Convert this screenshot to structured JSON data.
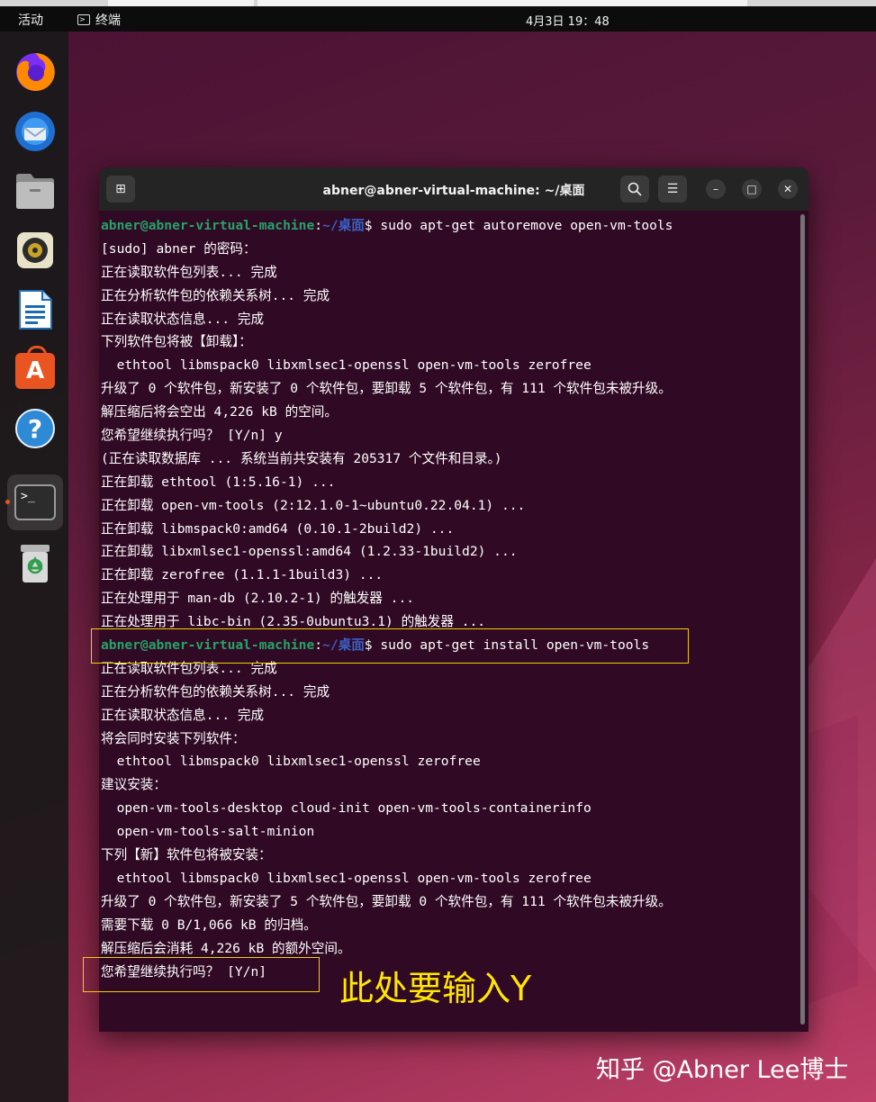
{
  "topbar": {
    "activities": "活动",
    "app_name": "终端",
    "clock": "4月3日 19：48"
  },
  "dock": {
    "items": [
      {
        "icon": "firefox-icon"
      },
      {
        "icon": "thunderbird-icon"
      },
      {
        "icon": "files-icon"
      },
      {
        "icon": "rhythmbox-icon"
      },
      {
        "icon": "libreoffice-writer-icon"
      },
      {
        "icon": "app-center-icon"
      },
      {
        "icon": "help-icon"
      },
      {
        "icon": "terminal-icon"
      },
      {
        "icon": "trash-icon"
      }
    ],
    "help_glyph": "?",
    "app_center_glyph": "A",
    "terminal_glyph": ">_"
  },
  "window": {
    "title": "abner@abner-virtual-machine: ~/桌面",
    "search_glyph": "🔍",
    "menu_glyph": "☰",
    "minimize_glyph": "–",
    "maximize_glyph": "□",
    "close_glyph": "✕",
    "newtab_glyph": "⊞"
  },
  "terminal": {
    "prompt_user": "abner@abner-virtual-machine",
    "prompt_sep": ":",
    "prompt_path": "~/桌面",
    "prompt_dollar": "$ ",
    "lines": [
      {
        "type": "prompt",
        "cmd": "sudo apt-get autoremove open-vm-tools"
      },
      {
        "type": "text",
        "text": "[sudo] abner 的密码："
      },
      {
        "type": "text",
        "text": "正在读取软件包列表... 完成"
      },
      {
        "type": "text",
        "text": "正在分析软件包的依赖关系树... 完成"
      },
      {
        "type": "text",
        "text": "正在读取状态信息... 完成"
      },
      {
        "type": "text",
        "text": "下列软件包将被【卸载】："
      },
      {
        "type": "text",
        "text": "  ethtool libmspack0 libxmlsec1-openssl open-vm-tools zerofree"
      },
      {
        "type": "text",
        "text": "升级了 0 个软件包，新安装了 0 个软件包，要卸载 5 个软件包，有 111 个软件包未被升级。"
      },
      {
        "type": "text",
        "text": "解压缩后将会空出 4,226 kB 的空间。"
      },
      {
        "type": "text",
        "text": "您希望继续执行吗？ [Y/n] y"
      },
      {
        "type": "text",
        "text": "(正在读取数据库 ... 系统当前共安装有 205317 个文件和目录。)"
      },
      {
        "type": "text",
        "text": "正在卸载 ethtool (1:5.16-1) ..."
      },
      {
        "type": "text",
        "text": "正在卸载 open-vm-tools (2:12.1.0-1~ubuntu0.22.04.1) ..."
      },
      {
        "type": "text",
        "text": "正在卸载 libmspack0:amd64 (0.10.1-2build2) ..."
      },
      {
        "type": "text",
        "text": "正在卸载 libxmlsec1-openssl:amd64 (1.2.33-1build2) ..."
      },
      {
        "type": "text",
        "text": "正在卸载 zerofree (1.1.1-1build3) ..."
      },
      {
        "type": "text",
        "text": "正在处理用于 man-db (2.10.2-1) 的触发器 ..."
      },
      {
        "type": "text",
        "text": "正在处理用于 libc-bin (2.35-0ubuntu3.1) 的触发器 ..."
      },
      {
        "type": "prompt",
        "cmd": "sudo apt-get install open-vm-tools"
      },
      {
        "type": "text",
        "text": "正在读取软件包列表... 完成"
      },
      {
        "type": "text",
        "text": "正在分析软件包的依赖关系树... 完成"
      },
      {
        "type": "text",
        "text": "正在读取状态信息... 完成"
      },
      {
        "type": "text",
        "text": "将会同时安装下列软件："
      },
      {
        "type": "text",
        "text": "  ethtool libmspack0 libxmlsec1-openssl zerofree"
      },
      {
        "type": "text",
        "text": "建议安装："
      },
      {
        "type": "text",
        "text": "  open-vm-tools-desktop cloud-init open-vm-tools-containerinfo"
      },
      {
        "type": "text",
        "text": "  open-vm-tools-salt-minion"
      },
      {
        "type": "text",
        "text": "下列【新】软件包将被安装："
      },
      {
        "type": "text",
        "text": "  ethtool libmspack0 libxmlsec1-openssl open-vm-tools zerofree"
      },
      {
        "type": "text",
        "text": "升级了 0 个软件包，新安装了 5 个软件包，要卸载 0 个软件包，有 111 个软件包未被升级。"
      },
      {
        "type": "text",
        "text": "需要下载 0 B/1,066 kB 的归档。"
      },
      {
        "type": "text",
        "text": "解压缩后会消耗 4,226 kB 的额外空间。"
      },
      {
        "type": "text",
        "text": "您希望继续执行吗？ [Y/n]"
      }
    ]
  },
  "annotation": {
    "note": "此处要输入Y",
    "color": "#ffe600"
  },
  "watermark": "知乎 @Abner Lee博士",
  "colors": {
    "terminal_bg": "#300a24",
    "prompt_user": "#26a269",
    "prompt_path": "#3b5fc2",
    "accent": "#e95420"
  }
}
